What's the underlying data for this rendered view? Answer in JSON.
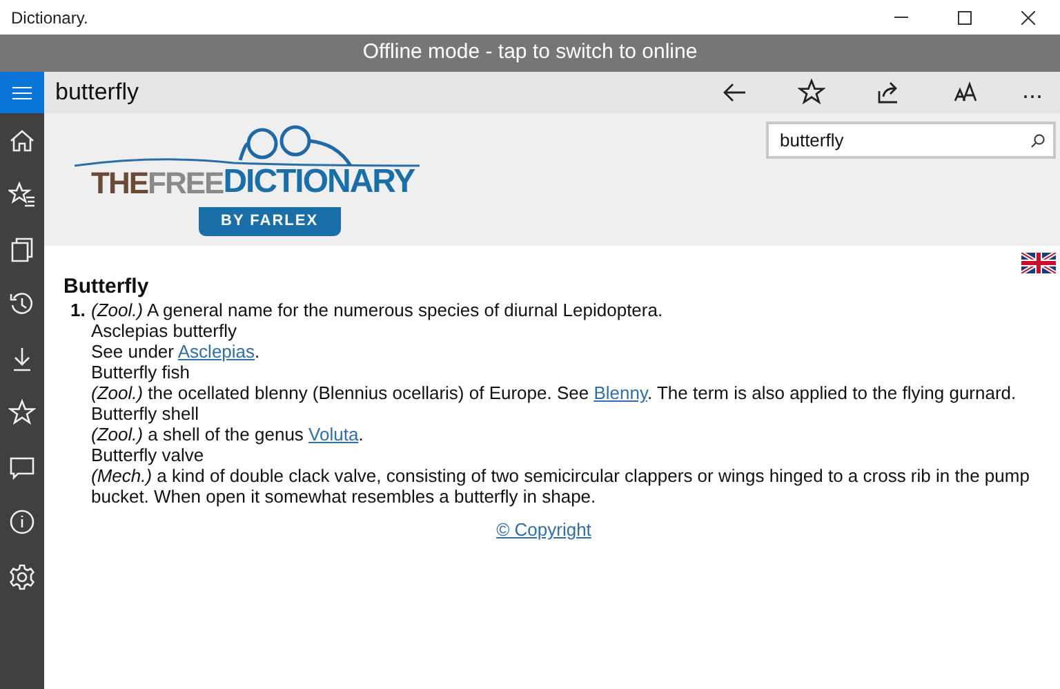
{
  "window": {
    "title": "Dictionary."
  },
  "banner": "Offline mode - tap to switch to online",
  "header": {
    "title": "butterfly",
    "more": "..."
  },
  "logo": {
    "the": "THE",
    "free": "FREE",
    "dictionary": "DICTIONARY",
    "byline": "BY FARLEX"
  },
  "search": {
    "value": "butterfly"
  },
  "entry": {
    "headword": "Butterfly",
    "number": "1.",
    "lines": [
      [
        {
          "kind": "text",
          "text": "*(Zool.)* A general name for the numerous species of diurnal Lepidoptera."
        }
      ],
      [
        {
          "kind": "text",
          "text": "Asclepias butterfly"
        }
      ],
      [
        {
          "kind": "text",
          "text": "See under "
        },
        {
          "kind": "link",
          "text": "Asclepias"
        },
        {
          "kind": "text",
          "text": "."
        }
      ],
      [
        {
          "kind": "text",
          "text": "Butterfly fish"
        }
      ],
      [
        {
          "kind": "text",
          "text": "*(Zool.)* the ocellated blenny (Blennius ocellaris) of Europe. See "
        },
        {
          "kind": "link",
          "text": "Blenny"
        },
        {
          "kind": "text",
          "text": ". The term is also applied to the flying gurnard."
        }
      ],
      [
        {
          "kind": "text",
          "text": "Butterfly shell"
        }
      ],
      [
        {
          "kind": "text",
          "text": "*(Zool.)* a shell of the genus "
        },
        {
          "kind": "link",
          "text": "Voluta"
        },
        {
          "kind": "text",
          "text": "."
        }
      ],
      [
        {
          "kind": "text",
          "text": "Butterfly valve"
        }
      ],
      [
        {
          "kind": "text",
          "text": "*(Mech.)* a kind of double clack valve, consisting of two semicircular clappers or wings hinged to a cross rib in the pump bucket. When open it somewhat resembles a butterfly in shape."
        }
      ]
    ]
  },
  "footer": {
    "copyright": "© Copyright"
  }
}
